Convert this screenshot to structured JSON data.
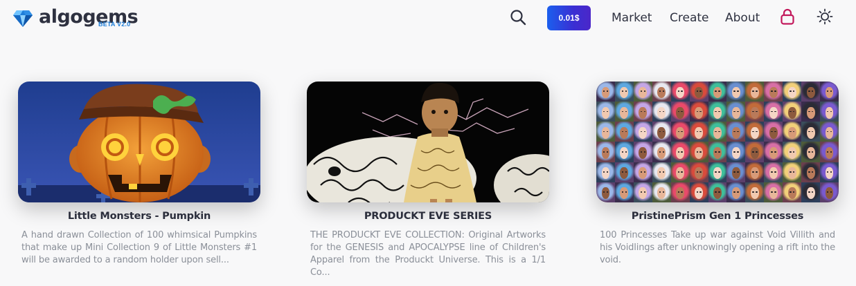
{
  "brand": {
    "name": "algogems",
    "badge": "BETA V2.0"
  },
  "header": {
    "price_label": "0.01$",
    "nav": {
      "market": "Market",
      "create": "Create",
      "about": "About"
    },
    "icons": [
      "search-icon",
      "lock-icon",
      "sun-icon"
    ]
  },
  "colors": {
    "accent_gradient_start": "#1b5fee",
    "accent_gradient_end": "#4b27c9",
    "lock_icon": "#c2185b",
    "beta_badge": "#1f7ed8"
  },
  "collections": [
    {
      "title": "Little Monsters - Pumpkin",
      "description": "A hand drawn Collection of 100 whimsical Pumpkins that make up Mini Collection 9 of Little Monsters #1 will be awarded to a random holder upon sell..."
    },
    {
      "title": "PRODUCKT EVE SERIES",
      "description": "THE PRODUCKT EVE COLLECTION: Original Artworks for the GENESIS and APOCALYPSE line of Children's Apparel from the Produckt Universe. This is a 1/1 Co..."
    },
    {
      "title": "PristinePrism Gen 1 Princesses",
      "description": "100 Princesses Take up war against Void Villith and his Voidlings after unknowingly opening a rift into the void."
    }
  ]
}
